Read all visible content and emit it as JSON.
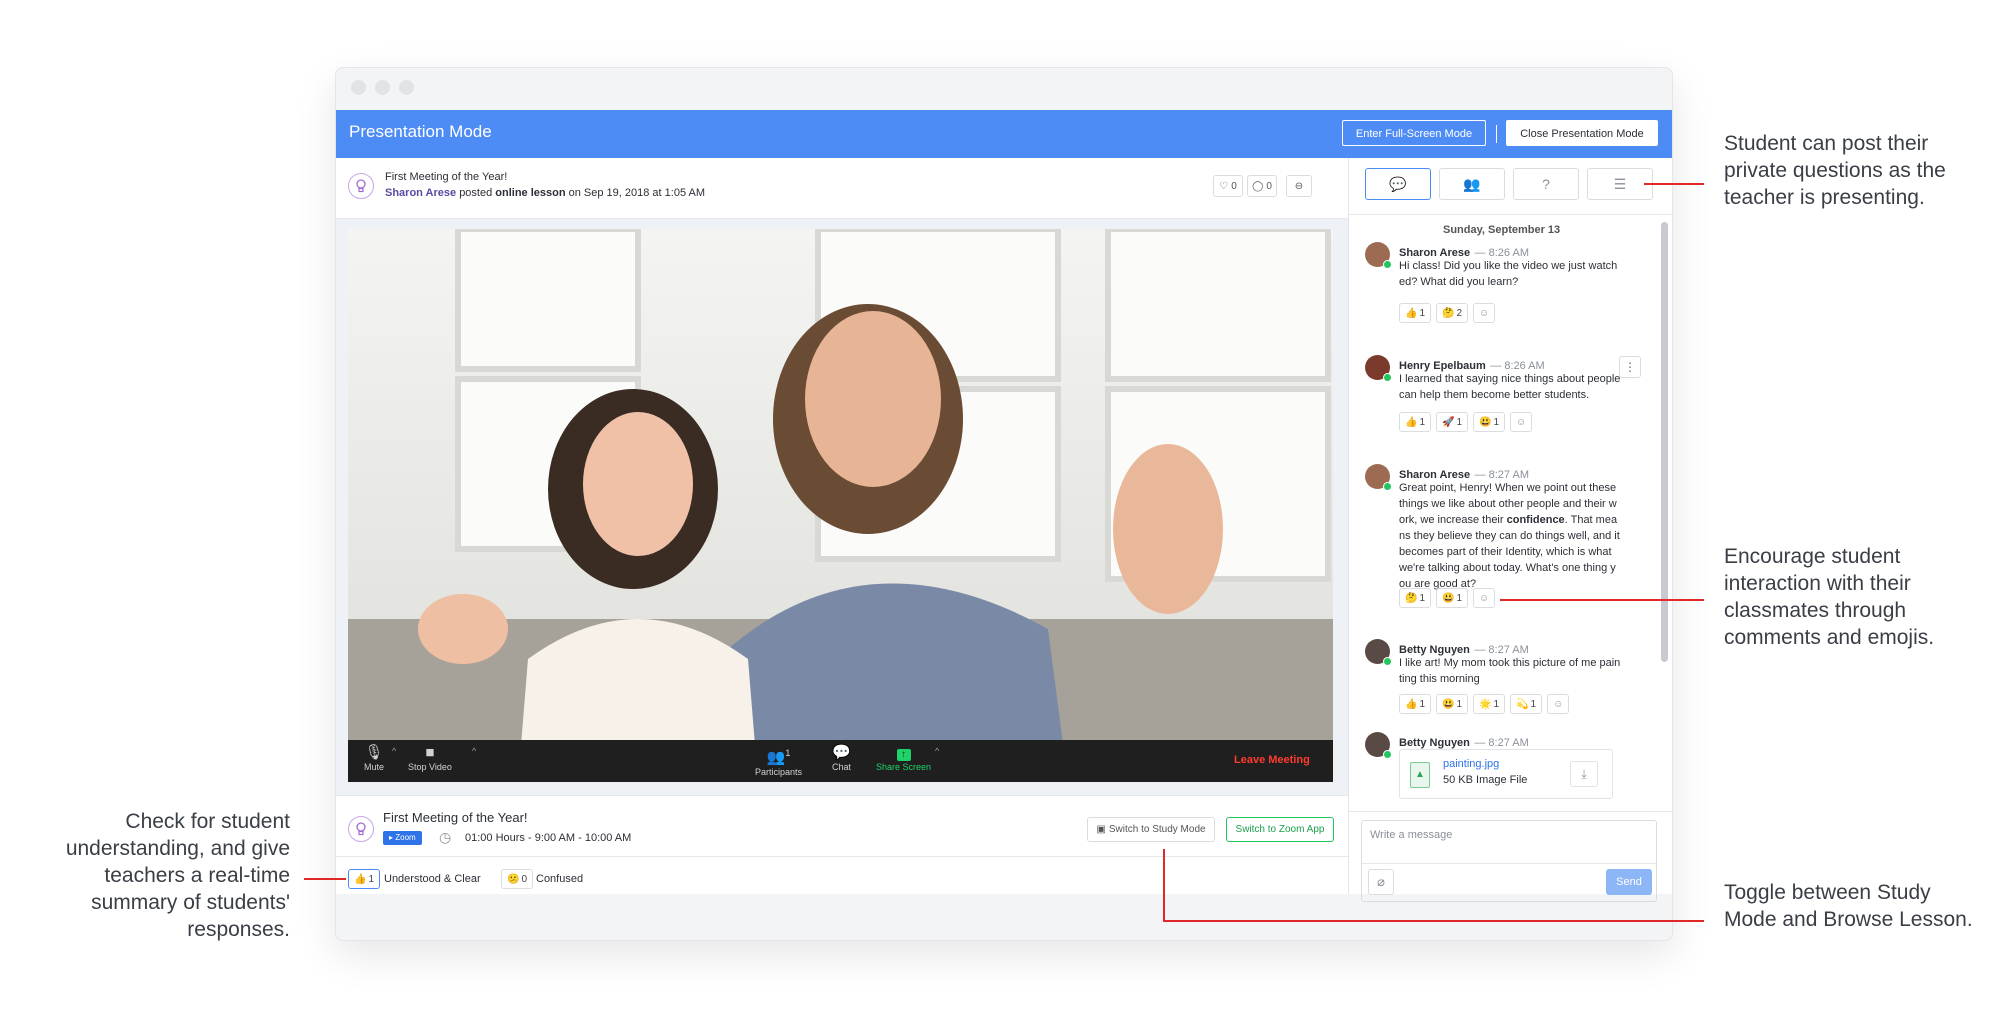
{
  "window": {
    "title": "Presentation Mode"
  },
  "header": {
    "fullscreen_button": "Enter Full-Screen Mode",
    "close_button": "Close Presentation Mode"
  },
  "post": {
    "title": "First Meeting of the Year!",
    "author": "Sharon Arese",
    "verb": "posted",
    "type": "online lesson",
    "date": "on Sep 19, 2018 at 1:05 AM",
    "likes": "0",
    "comments": "0"
  },
  "zoom_controls": {
    "mute": "Mute",
    "stop_video": "Stop Video",
    "participants": "Participants",
    "participants_count": "1",
    "chat": "Chat",
    "share_screen": "Share Screen",
    "leave": "Leave Meeting"
  },
  "meeting": {
    "title": "First Meeting of the Year!",
    "badge": "Zoom",
    "time": "01:00 Hours - 9:00 AM - 10:00 AM",
    "study_mode_button": "Switch to Study Mode",
    "zoom_app_button": "Switch to Zoom App",
    "responses": [
      {
        "emoji": "👍",
        "count": "1",
        "label": "Understood & Clear"
      },
      {
        "emoji": "😕",
        "count": "0",
        "label": "Confused"
      }
    ]
  },
  "chat": {
    "date_header": "Sunday, September 13",
    "messages": [
      {
        "name": "Sharon Arese",
        "time": "— 8:26 AM",
        "text": "Hi class! Did you like the video we just watched? What did you learn?",
        "reactions": [
          {
            "emoji": "👍",
            "count": "1"
          },
          {
            "emoji": "🤔",
            "count": "2"
          }
        ]
      },
      {
        "name": "Henry Epelbaum",
        "time": "— 8:26 AM",
        "text": "I learned that saying nice things about people can help them become better students.",
        "reactions": [
          {
            "emoji": "👍",
            "count": "1"
          },
          {
            "emoji": "🚀",
            "count": "1"
          },
          {
            "emoji": "😃",
            "count": "1"
          }
        ]
      },
      {
        "name": "Sharon Arese",
        "time": "— 8:27 AM",
        "text_before": "Great point, Henry! When we point out these things we like about other people and their work, we increase their ",
        "text_bold": "confidence",
        "text_after": ". That means they believe they can do things well, and it becomes part of their Identity, which is what we're talking about today. What's one thing you are good at?",
        "reactions": [
          {
            "emoji": "🤔",
            "count": "1"
          },
          {
            "emoji": "😃",
            "count": "1"
          }
        ]
      },
      {
        "name": "Betty Nguyen",
        "time": "— 8:27 AM",
        "text": "I like art! My mom took this picture of me painting this morning",
        "reactions": [
          {
            "emoji": "👍",
            "count": "1"
          },
          {
            "emoji": "😃",
            "count": "1"
          },
          {
            "emoji": "🌟",
            "count": "1"
          },
          {
            "emoji": "💫",
            "count": "1"
          }
        ]
      },
      {
        "name": "Betty Nguyen",
        "time": "— 8:27 AM",
        "file_name": "painting.jpg",
        "file_size": "50 KB Image File"
      }
    ],
    "composer_placeholder": "Write a message",
    "send_button": "Send"
  },
  "annotations": {
    "private_questions": "Student can post their private questions as the teacher is presenting.",
    "interaction": "Encourage student interaction with their classmates through comments and emojis.",
    "understanding": "Check for student understanding, and give teachers a real-time summary of students' responses.",
    "toggle": "Toggle between Study Mode and Browse Lesson."
  },
  "colors": {
    "accent": "#4d8cf5",
    "annotation_line": "#e02828",
    "leave": "#ff3b30",
    "share": "#1fd26a"
  },
  "icons": [
    "lightbulb-icon",
    "heart-icon",
    "comment-icon",
    "link-icon",
    "chat-icon",
    "users-icon",
    "question-icon",
    "list-icon",
    "mic-icon",
    "video-icon",
    "participants-icon",
    "chat-bubble-icon",
    "share-screen-icon",
    "clock-icon",
    "study-mode-icon",
    "image-file-icon",
    "download-icon",
    "attach-icon",
    "more-icon",
    "add-reaction-icon"
  ]
}
